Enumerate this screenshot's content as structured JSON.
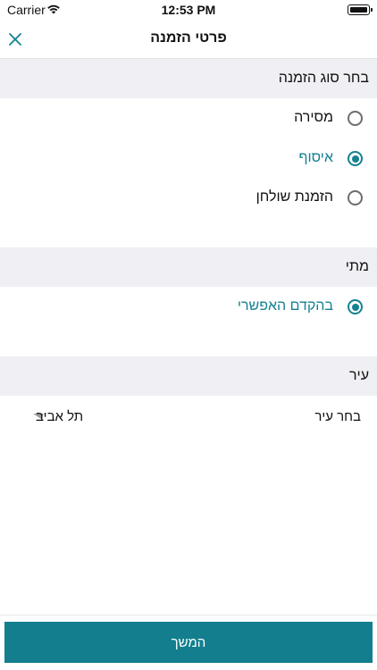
{
  "status_bar": {
    "carrier": "Carrier",
    "time": "12:53 PM",
    "wifi_icon": "wifi-icon",
    "battery_icon": "battery-full-icon"
  },
  "header": {
    "title": "פרטי הזמנה",
    "close_icon": "close-icon"
  },
  "order_type": {
    "heading": "בחר סוג הזמנה",
    "options": [
      {
        "label": "מסירה",
        "selected": false
      },
      {
        "label": "איסוף",
        "selected": true
      },
      {
        "label": "הזמנת שולחן",
        "selected": false
      }
    ]
  },
  "when": {
    "heading": "מתי",
    "options": [
      {
        "label": "בהקדם האפשרי",
        "selected": true
      }
    ]
  },
  "city": {
    "heading": "עיר",
    "prompt": "בחר עיר",
    "value": "תל אביב"
  },
  "footer": {
    "continue_label": "המשך"
  },
  "colors": {
    "accent": "#148291",
    "button_bg": "#137f8e",
    "section_bg": "#efeff4"
  }
}
